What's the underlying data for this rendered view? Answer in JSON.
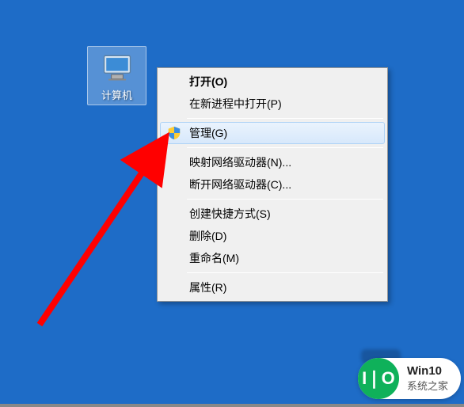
{
  "desktop": {
    "icon_name": "computer-icon",
    "icon_label": "计算机"
  },
  "context_menu": {
    "items": [
      {
        "label": "打开(O)",
        "bold": true,
        "icon": null
      },
      {
        "label": "在新进程中打开(P)",
        "icon": null
      },
      {
        "separator": true
      },
      {
        "label": "管理(G)",
        "icon": "shield-icon",
        "highlighted": true
      },
      {
        "separator": true
      },
      {
        "label": "映射网络驱动器(N)...",
        "icon": null
      },
      {
        "label": "断开网络驱动器(C)...",
        "icon": null
      },
      {
        "separator": true
      },
      {
        "label": "创建快捷方式(S)",
        "icon": null
      },
      {
        "label": "删除(D)",
        "icon": null
      },
      {
        "label": "重命名(M)",
        "icon": null
      },
      {
        "separator": true
      },
      {
        "label": "属性(R)",
        "icon": null
      }
    ]
  },
  "watermark": {
    "logo_text": "I❘O",
    "title": "Win10",
    "subtitle": "系统之家"
  },
  "annotation": {
    "arrow_color": "#ff0000"
  }
}
